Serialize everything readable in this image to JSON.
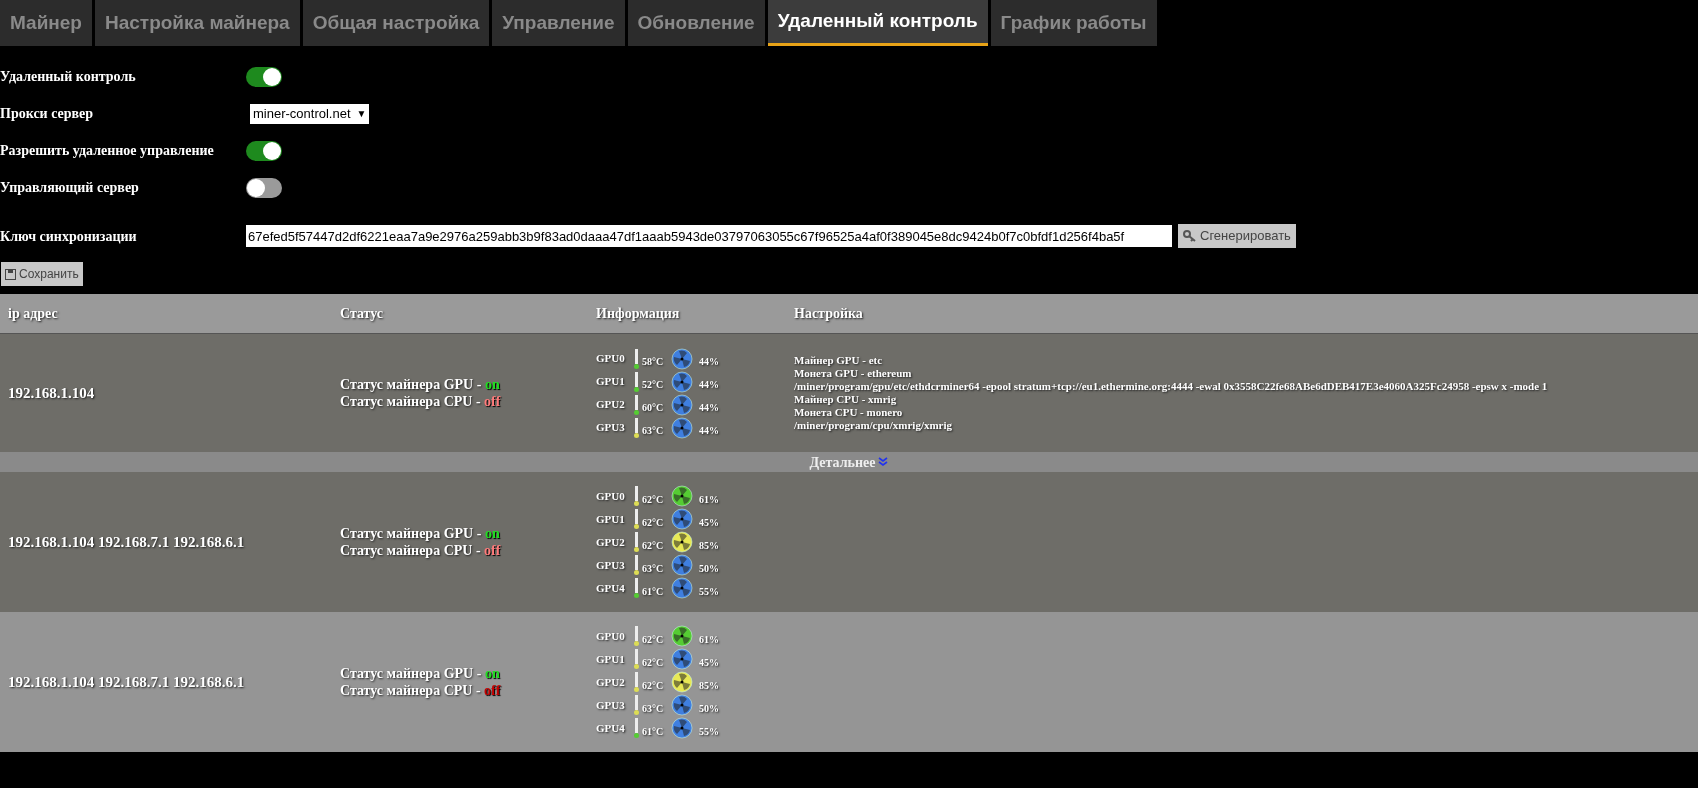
{
  "tabs": [
    {
      "label": "Майнер",
      "selected": false
    },
    {
      "label": "Настройка майнера",
      "selected": false
    },
    {
      "label": "Общая настройка",
      "selected": false
    },
    {
      "label": "Управление",
      "selected": false
    },
    {
      "label": "Обновление",
      "selected": false
    },
    {
      "label": "Удаленный контроль",
      "selected": true
    },
    {
      "label": "График работы",
      "selected": false
    }
  ],
  "settings": [
    {
      "kind": "toggle",
      "label": "Удаленный контроль",
      "on": true
    },
    {
      "kind": "select",
      "label": "Прокси сервер",
      "value": "miner-control.net",
      "caret": "▼"
    },
    {
      "kind": "toggle",
      "label": "Разрешить удаленное управление",
      "on": true
    },
    {
      "kind": "toggle",
      "label": "Управляющий сервер",
      "on": false
    },
    {
      "kind": "key",
      "label": "Ключ синхронизации",
      "value": "67efed5f57447d2df6221eaa7a9e2976a259abb3b9f83ad0daaa47df1aaab5943de03797063055c67f96525a4af0f389045e8dc9424b0f7c0bfdf1d256f4ba5f",
      "button": "Сгенерировать"
    }
  ],
  "save_button": "Сохранить",
  "table": {
    "columns": [
      "ip адрес",
      "Статус",
      "Информация",
      "Настройка"
    ],
    "rows": [
      {
        "ip": "192.168.1.104",
        "status": [
          {
            "label": "Статус майнера GPU - ",
            "value": "on",
            "on": true
          },
          {
            "label": "Статус майнера CPU - ",
            "value": "off",
            "on": false
          }
        ],
        "gpus": [
          {
            "name": "GPU0",
            "temp": "58°C",
            "thermometer": {
              "color": "#55cc33"
            },
            "color": "#3f7fe0",
            "fan": "44%"
          },
          {
            "name": "GPU1",
            "temp": "52°C",
            "thermometer": {
              "color": "#55cc33"
            },
            "color": "#3f7fe0",
            "fan": "44%"
          },
          {
            "name": "GPU2",
            "temp": "60°C",
            "thermometer": {
              "color": "#55cc33"
            },
            "color": "#3f7fe0",
            "fan": "44%"
          },
          {
            "name": "GPU3",
            "temp": "63°C",
            "thermometer": {
              "color": "#dddd55"
            },
            "color": "#3f7fe0",
            "fan": "44%"
          }
        ],
        "config": [
          "Майнер GPU - etc",
          "Монета GPU - ethereum",
          "/miner/program/gpu/etc/ethdcrminer64 -epool stratum+tcp://eu1.ethermine.org:4444 -ewal 0x3558C22fe68ABe6dDEB417E3e4060A325Fc24958 -epsw x -mode 1",
          "Майнер CPU - xmrig",
          "Монета CPU - monero",
          "/miner/program/cpu/xmrig/xmrig"
        ],
        "details": "Детальнее"
      },
      {
        "ip": "192.168.1.104 192.168.7.1 192.168.6.1",
        "status": [
          {
            "label": "Статус майнера GPU - ",
            "value": "on",
            "on": true
          },
          {
            "label": "Статус майнера CPU - ",
            "value": "off",
            "on": false
          }
        ],
        "gpus": [
          {
            "name": "GPU0",
            "temp": "62°C",
            "thermometer": {
              "color": "#dddd55"
            },
            "color": "#55cc33",
            "fan": "61%"
          },
          {
            "name": "GPU1",
            "temp": "62°C",
            "thermometer": {
              "color": "#dddd55"
            },
            "color": "#3f7fe0",
            "fan": "45%"
          },
          {
            "name": "GPU2",
            "temp": "62°C",
            "thermometer": {
              "color": "#dddd55"
            },
            "color": "#e8e855",
            "fan": "85%"
          },
          {
            "name": "GPU3",
            "temp": "63°C",
            "thermometer": {
              "color": "#dddd55"
            },
            "color": "#3f7fe0",
            "fan": "50%"
          },
          {
            "name": "GPU4",
            "temp": "61°C",
            "thermometer": {
              "color": "#55cc33"
            },
            "color": "#3f7fe0",
            "fan": "55%"
          }
        ]
      },
      {
        "ip": "192.168.1.104 192.168.7.1 192.168.6.1",
        "status": [
          {
            "label": "Статус майнера GPU - ",
            "value": "on",
            "on": true
          },
          {
            "label": "Статус майнера CPU - ",
            "value": "off",
            "on": false
          }
        ],
        "gpus": [
          {
            "name": "GPU0",
            "temp": "62°C",
            "thermometer": {
              "color": "#dddd55"
            },
            "color": "#55cc33",
            "fan": "61%"
          },
          {
            "name": "GPU1",
            "temp": "62°C",
            "thermometer": {
              "color": "#dddd55"
            },
            "color": "#3f7fe0",
            "fan": "45%"
          },
          {
            "name": "GPU2",
            "temp": "62°C",
            "thermometer": {
              "color": "#dddd55"
            },
            "color": "#e8e855",
            "fan": "85%"
          },
          {
            "name": "GPU3",
            "temp": "63°C",
            "thermometer": {
              "color": "#dddd55"
            },
            "color": "#3f7fe0",
            "fan": "50%"
          },
          {
            "name": "GPU4",
            "temp": "61°C",
            "thermometer": {
              "color": "#55cc33"
            },
            "color": "#3f7fe0",
            "fan": "55%"
          }
        ]
      }
    ]
  }
}
